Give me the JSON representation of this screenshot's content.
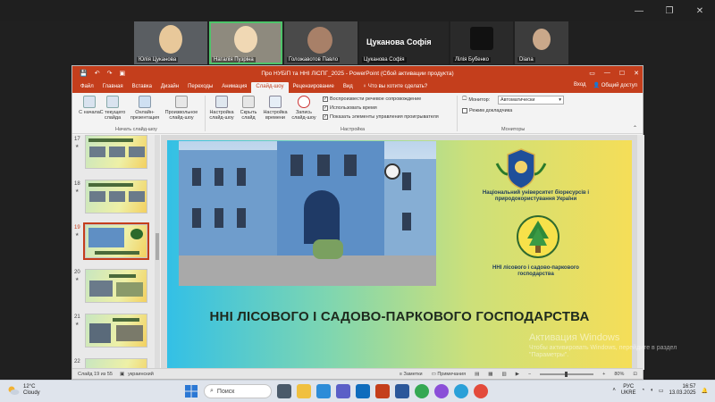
{
  "meeting": {
    "participants": [
      {
        "name": "Юлія Цуканова"
      },
      {
        "name": "Наталія Пузріна"
      },
      {
        "name": "Голожавотов Павло"
      },
      {
        "name": "Цуканова Софія"
      },
      {
        "name": "Цуканова Софія"
      },
      {
        "name": "Лілія Бубенко"
      },
      {
        "name": "Diana"
      }
    ]
  },
  "ppt": {
    "title": "Про НУБіП та ННІ ЛіСПГ_2025 - PowerPoint (Сбой активации продукта)",
    "account": "Вход",
    "share": "Общий доступ",
    "tabs": [
      "Файл",
      "Главная",
      "Вставка",
      "Дизайн",
      "Переходы",
      "Анимация",
      "Слайд-шоу",
      "Рецензирование",
      "Вид"
    ],
    "active_tab": "Слайд-шоу",
    "tell_me": "Что вы хотите сделать?",
    "ribbon": {
      "from_start": "С начала",
      "from_current": "С текущего слайда",
      "online": "Онлайн-презентация",
      "custom": "Произвольное слайд-шоу",
      "group_start": "Начать слайд-шоу",
      "setup": "Настройка слайд-шоу",
      "hide": "Скрыть слайд",
      "rehearse": "Настройка времени",
      "record": "Запись слайд-шоу",
      "group_setup": "Настройка",
      "check_narration": "Воспроизвести речевое сопровождение",
      "check_timings": "Использовать время",
      "check_controls": "Показать элементы управления проигрывателя",
      "monitor_label": "Монитор:",
      "monitor_value": "Автоматически",
      "presenter_view": "Режим докладчика",
      "group_monitors": "Мониторы"
    },
    "thumbnails": [
      {
        "num": "17"
      },
      {
        "num": "18"
      },
      {
        "num": "19"
      },
      {
        "num": "20"
      },
      {
        "num": "21"
      },
      {
        "num": "22"
      }
    ],
    "slide": {
      "title": "ННІ ЛІСОВОГО І САДОВО-ПАРКОВОГО ГОСПОДАРСТВА",
      "university": "Національний університет біоресурсів і природокористування України",
      "institute": "ННІ лісового і садово-паркового господарства"
    },
    "status": {
      "slide_info": "Слайд 19 из 55",
      "language": "украинский",
      "notes": "Заметки",
      "comments": "Примечания",
      "zoom": "80%"
    }
  },
  "activation": {
    "title": "Активация Windows",
    "text": "Чтобы активировать Windows, перейдите в раздел \"Параметры\"."
  },
  "taskbar": {
    "temp": "12°C",
    "weather": "Cloudy",
    "search": "Поиск",
    "lang_top": "РУС",
    "lang_bottom": "UKRE",
    "time": "16:57",
    "date": "13.03.2025"
  },
  "colors": {
    "ppt_accent": "#c43e1c",
    "active_speaker": "#4ec46a"
  }
}
